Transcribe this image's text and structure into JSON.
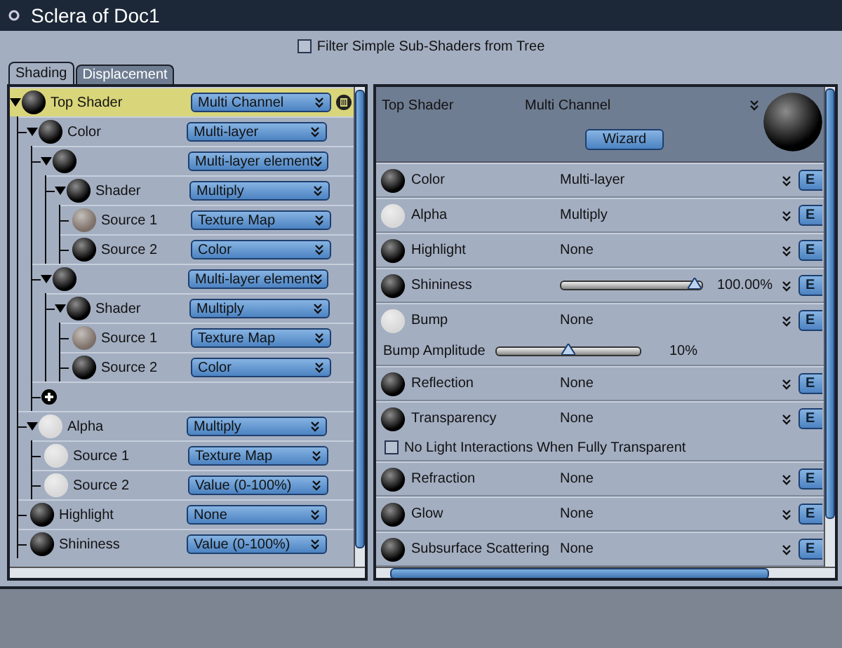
{
  "window": {
    "title": "Sclera of Doc1"
  },
  "filter": {
    "label": "Filter Simple Sub-Shaders from Tree",
    "checked": false
  },
  "tabs": [
    {
      "label": "Shading",
      "selected": true
    },
    {
      "label": "Displacement",
      "selected": false
    }
  ],
  "tree": [
    {
      "kind": "shader",
      "name": "Top Shader",
      "value": "Multi Channel",
      "color": "#000000",
      "selected": true,
      "expanded": true,
      "children": [
        {
          "kind": "shader",
          "name": "Color",
          "value": "Multi-layer",
          "color": "#000000",
          "selected": false,
          "expanded": true,
          "children": [
            {
              "kind": "shader",
              "value": "Multi-layer element",
              "color": "#000000",
              "selected": false,
              "expanded": true,
              "children": [
                {
                  "kind": "shader",
                  "name": "Shader",
                  "value": "Multiply",
                  "color": "#000000",
                  "selected": false,
                  "expanded": true,
                  "children": [
                    {
                      "kind": "shader",
                      "name": "Source 1",
                      "value": "Texture Map",
                      "color": "#7d7068",
                      "selected": false
                    },
                    {
                      "kind": "shader",
                      "name": "Source 2",
                      "value": "Color",
                      "color": "#000000",
                      "selected": false
                    }
                  ]
                }
              ]
            },
            {
              "kind": "shader",
              "value": "Multi-layer element",
              "color": "#000000",
              "selected": false,
              "expanded": true,
              "children": [
                {
                  "kind": "shader",
                  "name": "Shader",
                  "value": "Multiply",
                  "color": "#000000",
                  "selected": false,
                  "expanded": true,
                  "children": [
                    {
                      "kind": "shader",
                      "name": "Source 1",
                      "value": "Texture Map",
                      "color": "#7d7068",
                      "selected": false
                    },
                    {
                      "kind": "shader",
                      "name": "Source 2",
                      "value": "Color",
                      "color": "#000000",
                      "selected": false
                    }
                  ]
                }
              ]
            },
            {
              "kind": "add"
            }
          ]
        },
        {
          "kind": "shader",
          "name": "Alpha",
          "value": "Multiply",
          "color": "#d8d8d8",
          "selected": false,
          "expanded": true,
          "children": [
            {
              "kind": "shader",
              "name": "Source 1",
              "value": "Texture Map",
              "color": "#d8d8d8",
              "selected": false
            },
            {
              "kind": "shader",
              "name": "Source 2",
              "value": "Value (0-100%)",
              "color": "#d8d8d8",
              "selected": false
            }
          ]
        },
        {
          "kind": "shader",
          "name": "Highlight",
          "value": "None",
          "color": "#000000",
          "selected": false
        },
        {
          "kind": "shader",
          "name": "Shininess",
          "value": "Value (0-100%)",
          "color": "#000000",
          "selected": false
        }
      ]
    }
  ],
  "header": {
    "name": "Top Shader",
    "value": "Multi Channel",
    "button": "Wizard",
    "color": "#000000"
  },
  "channels": [
    {
      "kind": "channel",
      "name": "Color",
      "value": "Multi-layer",
      "color": "#000000",
      "edit": "E"
    },
    {
      "kind": "channel",
      "name": "Alpha",
      "value": "Multiply",
      "color": "#d8d8d8",
      "edit": "E"
    },
    {
      "kind": "channel",
      "name": "Highlight",
      "value": "None",
      "color": "#000000",
      "edit": "E"
    },
    {
      "kind": "slider",
      "name": "Shininess",
      "level": 1.0,
      "reading": "100.00%",
      "color": "#000000",
      "edit": "E"
    },
    {
      "kind": "channel",
      "name": "Bump",
      "value": "None",
      "color": "#d8d8d8",
      "edit": "E",
      "sub": {
        "name": "Bump Amplitude",
        "level": 0.5,
        "reading": "10%"
      }
    },
    {
      "kind": "channel",
      "name": "Reflection",
      "value": "None",
      "color": "#000000",
      "edit": "E"
    },
    {
      "kind": "channel",
      "name": "Transparency",
      "value": "None",
      "color": "#000000",
      "edit": "E",
      "option": {
        "label": "No Light Interactions When Fully Transparent",
        "checked": false
      }
    },
    {
      "kind": "channel",
      "name": "Refraction",
      "value": "None",
      "color": "#000000",
      "edit": "E"
    },
    {
      "kind": "channel",
      "name": "Glow",
      "value": "None",
      "color": "#000000",
      "edit": "E"
    },
    {
      "kind": "channel",
      "name": "Subsurface Scattering",
      "value": "None",
      "color": "#000000",
      "edit": "E"
    }
  ]
}
